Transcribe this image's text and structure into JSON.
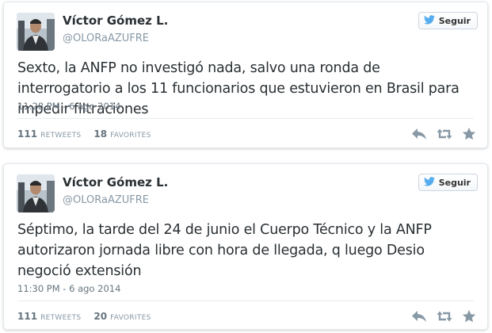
{
  "tweets": [
    {
      "author_name": "Víctor Gómez L.",
      "handle": "@OLORaAZUFRE",
      "follow_label": "Seguir",
      "text": "Sexto, la ANFP no investigó nada, salvo una ronda de interrogatorio a los 11 funcionarios que estuvieron en Brasil para impedir filtraciones",
      "timestamp": "11:28 PM - 6 ago 2014",
      "retweets_count": "111",
      "retweets_label": "RETWEETS",
      "favorites_count": "18",
      "favorites_label": "FAVORITES"
    },
    {
      "author_name": "Víctor Gómez L.",
      "handle": "@OLORaAZUFRE",
      "follow_label": "Seguir",
      "text": "Séptimo, la tarde del 24 de junio el Cuerpo Técnico y la ANFP autorizaron jornada libre con hora de llegada, q luego Desio negoció extensión",
      "timestamp": "11:30 PM - 6 ago 2014",
      "retweets_count": "111",
      "retweets_label": "RETWEETS",
      "favorites_count": "20",
      "favorites_label": "FAVORITES"
    }
  ],
  "icons": [
    "twitter-bird-icon",
    "reply-icon",
    "retweet-icon",
    "favorite-star-icon"
  ],
  "colors": {
    "twitter_blue": "#55acee",
    "action_gray": "#8899a6",
    "text": "#292f33"
  }
}
